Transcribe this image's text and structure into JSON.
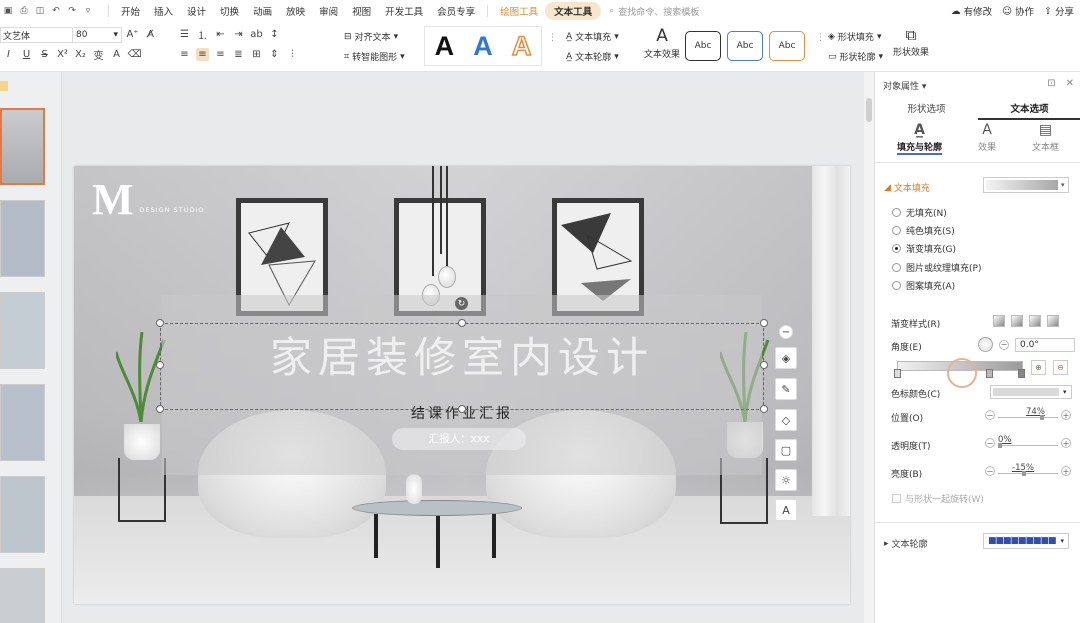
{
  "menubar": {
    "menus": [
      "开始",
      "插入",
      "设计",
      "切换",
      "动画",
      "放映",
      "审阅",
      "视图",
      "开发工具",
      "会员专享"
    ],
    "tool_tabs": [
      "绘图工具",
      "文本工具"
    ],
    "active_tab": "文本工具",
    "search_placeholder": "查找命令、搜索模板",
    "right": {
      "modified": "有修改",
      "collaborate": "协作",
      "share": "分享"
    }
  },
  "ribbon": {
    "font_name": "文艺体",
    "font_size": "80",
    "align_text": "对齐文本",
    "smart_shape": "转智能图形",
    "text_fill": "文本填充",
    "text_outline": "文本轮廓",
    "text_effect": "文本效果",
    "shape_fill": "形状填充",
    "shape_outline": "形状轮廓",
    "shape_effect": "形状效果",
    "wordart": [
      "A",
      "A",
      "A"
    ],
    "wordart_colors": [
      "#111111",
      "#2f79d4",
      "#e98d3a"
    ],
    "abc_styles": [
      {
        "label": "Abc",
        "border": "#333333"
      },
      {
        "label": "Abc",
        "border": "#4a7ed6"
      },
      {
        "label": "Abc",
        "border": "#e98d3a"
      }
    ]
  },
  "slide": {
    "logo_letter": "M",
    "logo_sub": "DESIGN STUDIO",
    "title": "家居装修室内设计",
    "subtitle": "结课作业汇报",
    "reporter": "汇报人：xxx"
  },
  "panel": {
    "header": "对象属性",
    "tabs": [
      "形状选项",
      "文本选项"
    ],
    "active_tab": "文本选项",
    "subtabs": [
      "填充与轮廓",
      "效果",
      "文本框"
    ],
    "text_fill_title": "文本填充",
    "fill_options": [
      "无填充(N)",
      "纯色填充(S)",
      "渐变填充(G)",
      "图片或纹理填充(P)",
      "图案填充(A)"
    ],
    "fill_selected": 2,
    "gradient_style": "渐变样式(R)",
    "angle_label": "角度(E)",
    "angle_value": "0.0°",
    "stop_color": "色标颜色(C)",
    "position_label": "位置(O)",
    "position_value": "74%",
    "transparency_label": "透明度(T)",
    "transparency_value": "0%",
    "brightness_label": "亮度(B)",
    "brightness_value": "-15%",
    "rotate_with_shape": "与形状一起旋转(W)",
    "text_outline_title": "文本轮廓"
  }
}
